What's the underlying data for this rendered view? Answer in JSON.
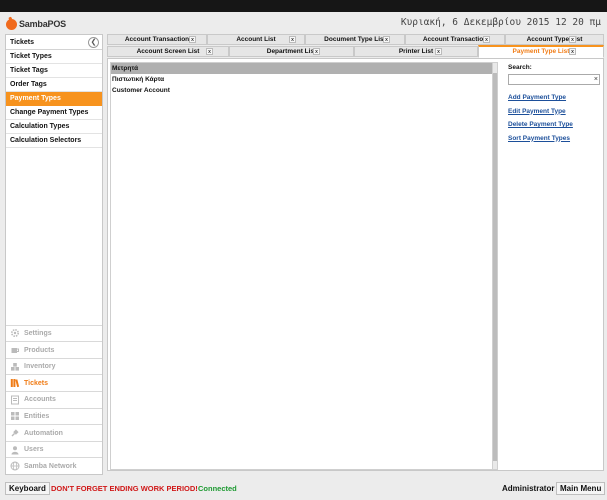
{
  "app": {
    "logo_text": "SambaPOS",
    "datetime": "Κυριακή, 6 Δεκεμβρίου 2015 12 20 πμ"
  },
  "sidebar": {
    "title": "Tickets",
    "items": [
      {
        "label": "Ticket Types"
      },
      {
        "label": "Ticket Tags"
      },
      {
        "label": "Order Tags"
      },
      {
        "label": "Payment Types",
        "active": true
      },
      {
        "label": "Change Payment Types"
      },
      {
        "label": "Calculation Types"
      },
      {
        "label": "Calculation Selectors"
      }
    ],
    "modules": [
      {
        "label": "Settings",
        "icon": "gear-icon"
      },
      {
        "label": "Products",
        "icon": "cup-icon"
      },
      {
        "label": "Inventory",
        "icon": "boxes-icon"
      },
      {
        "label": "Tickets",
        "icon": "books-icon",
        "active": true
      },
      {
        "label": "Accounts",
        "icon": "ledger-icon"
      },
      {
        "label": "Entities",
        "icon": "grid-icon"
      },
      {
        "label": "Automation",
        "icon": "plug-icon"
      },
      {
        "label": "Users",
        "icon": "user-icon"
      },
      {
        "label": "Samba Network",
        "icon": "globe-icon"
      }
    ]
  },
  "tabs": {
    "row1": [
      {
        "label": "Account Transaction"
      },
      {
        "label": "Account List"
      },
      {
        "label": "Document Type List"
      },
      {
        "label": "Account Transaction"
      },
      {
        "label": "Account Type List"
      }
    ],
    "row2": [
      {
        "label": "Account Screen List"
      },
      {
        "label": "Department List"
      },
      {
        "label": "Printer List"
      },
      {
        "label": "Payment Type List",
        "active": true
      }
    ],
    "close_glyph": "x"
  },
  "list": {
    "rows": [
      {
        "label": "Μετρητά",
        "selected": true
      },
      {
        "label": "Πιστωτική Κάρτα"
      },
      {
        "label": "Customer Account"
      }
    ]
  },
  "search": {
    "label": "Search:",
    "value": "",
    "clear_glyph": "×"
  },
  "actions": [
    {
      "label": "Add Payment Type"
    },
    {
      "label": "Edit Payment Type"
    },
    {
      "label": "Delete Payment Type"
    },
    {
      "label": "Sort Payment Types"
    }
  ],
  "statusbar": {
    "keyboard_label": "Keyboard",
    "warning": "DON'T FORGET ENDING WORK PERIOD!",
    "connection": "Connected",
    "user": "Administrator",
    "main_menu_label": "Main Menu"
  },
  "colors": {
    "accent": "#f7931e",
    "warning": "#d01818",
    "connected": "#1e9a32",
    "link": "#1c4f9a"
  }
}
